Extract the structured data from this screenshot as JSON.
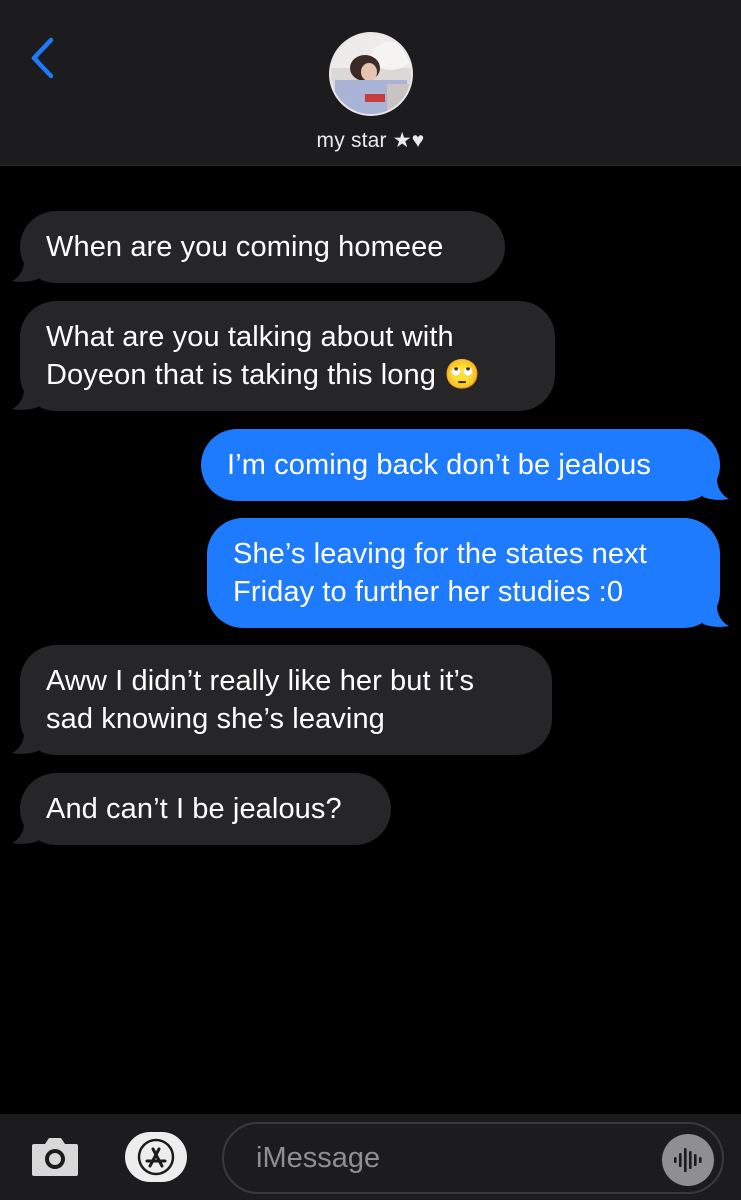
{
  "header": {
    "contact_name": "my star ★♥",
    "back_icon": "chevron-left-icon"
  },
  "messages": [
    {
      "direction": "incoming",
      "text": "When are you coming homeee"
    },
    {
      "direction": "incoming",
      "line1": "What are you talking about with",
      "line2": "Doyeon that is taking this long 🙄"
    },
    {
      "direction": "outgoing",
      "text": "I’m coming back don’t be jealous"
    },
    {
      "direction": "outgoing",
      "line1": "She’s leaving for the states next",
      "line2": "Friday to further her studies :0"
    },
    {
      "direction": "incoming",
      "line1": "Aww I didn’t really like her but it’s",
      "line2": "sad knowing she’s leaving"
    },
    {
      "direction": "incoming",
      "text": "And can’t I be jealous?"
    }
  ],
  "input_bar": {
    "placeholder": "iMessage",
    "icons": [
      "camera-icon",
      "app-store-icon",
      "audio-waveform-icon"
    ]
  },
  "colors": {
    "incoming_bubble": "#262628",
    "outgoing_bubble": "#1f7bfd",
    "accent": "#1f7bfd",
    "header_bg": "#1c1c1e"
  }
}
